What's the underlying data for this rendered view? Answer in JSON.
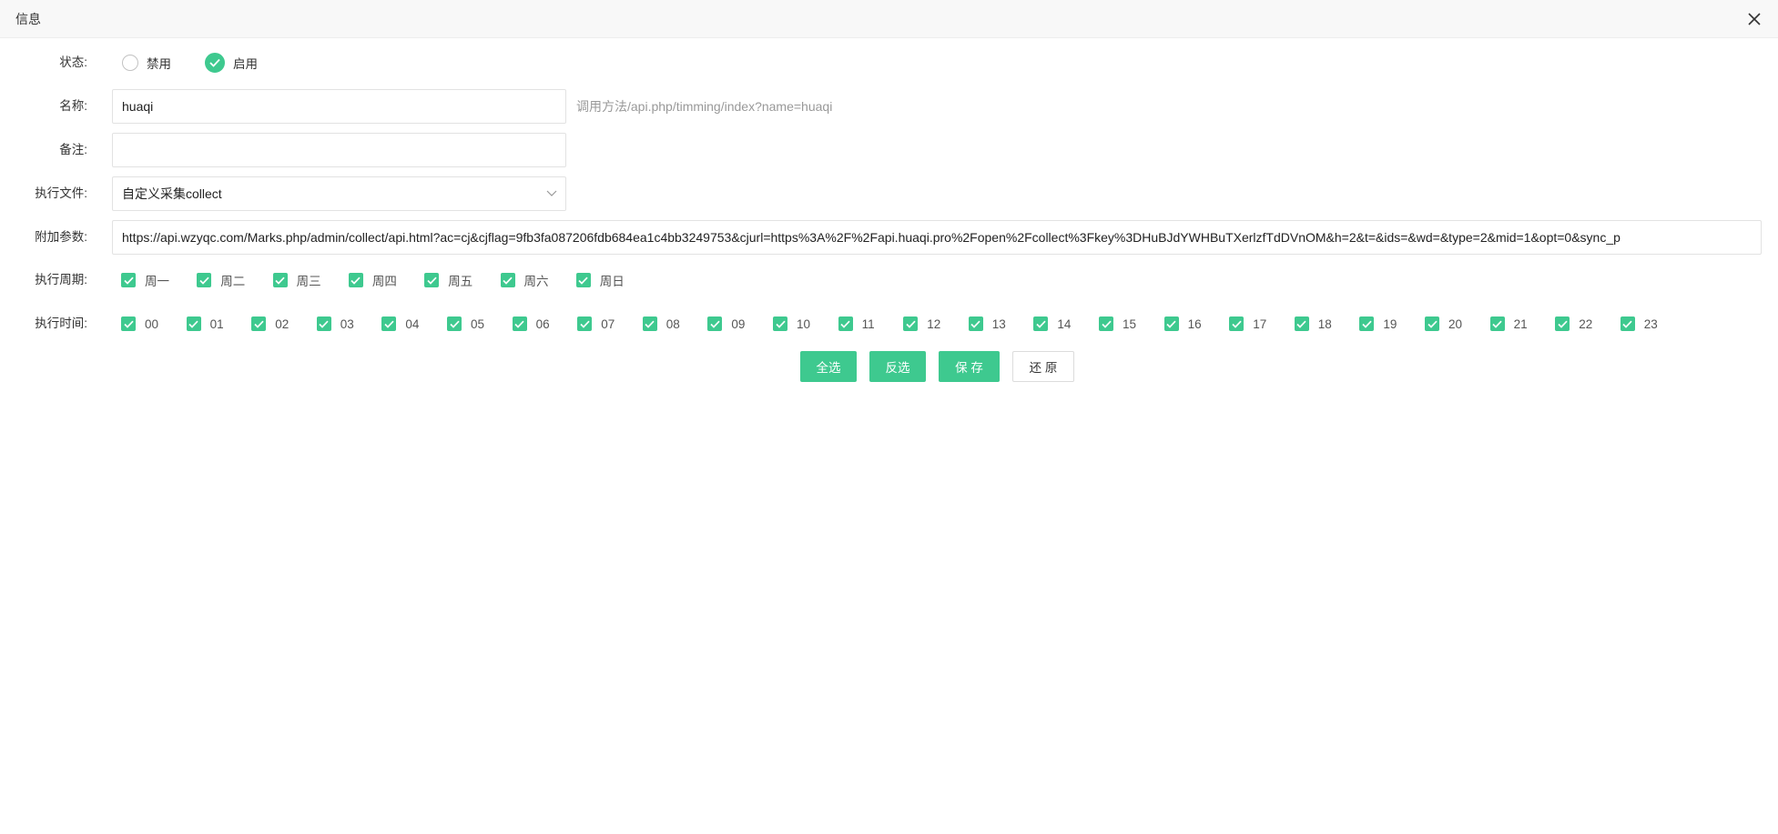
{
  "dialog": {
    "title": "信息"
  },
  "form": {
    "status": {
      "label": "状态:",
      "options": [
        {
          "label": "禁用",
          "selected": false
        },
        {
          "label": "启用",
          "selected": true
        }
      ]
    },
    "name": {
      "label": "名称:",
      "value": "huaqi",
      "hint": "调用方法/api.php/timming/index?name=huaqi"
    },
    "remark": {
      "label": "备注:",
      "value": ""
    },
    "exec_file": {
      "label": "执行文件:",
      "selected": "自定义采集collect"
    },
    "params": {
      "label": "附加参数:",
      "value": "https://api.wzyqc.com/Marks.php/admin/collect/api.html?ac=cj&cjflag=9fb3fa087206fdb684ea1c4bb3249753&cjurl=https%3A%2F%2Fapi.huaqi.pro%2Fopen%2Fcollect%3Fkey%3DHuBJdYWHBuTXerlzfTdDVnOM&h=2&t=&ids=&wd=&type=2&mid=1&opt=0&sync_p"
    },
    "weekdays": {
      "label": "执行周期:",
      "items": [
        {
          "label": "周一",
          "checked": true
        },
        {
          "label": "周二",
          "checked": true
        },
        {
          "label": "周三",
          "checked": true
        },
        {
          "label": "周四",
          "checked": true
        },
        {
          "label": "周五",
          "checked": true
        },
        {
          "label": "周六",
          "checked": true
        },
        {
          "label": "周日",
          "checked": true
        }
      ]
    },
    "hours": {
      "label": "执行时间:",
      "items": [
        {
          "label": "00",
          "checked": true
        },
        {
          "label": "01",
          "checked": true
        },
        {
          "label": "02",
          "checked": true
        },
        {
          "label": "03",
          "checked": true
        },
        {
          "label": "04",
          "checked": true
        },
        {
          "label": "05",
          "checked": true
        },
        {
          "label": "06",
          "checked": true
        },
        {
          "label": "07",
          "checked": true
        },
        {
          "label": "08",
          "checked": true
        },
        {
          "label": "09",
          "checked": true
        },
        {
          "label": "10",
          "checked": true
        },
        {
          "label": "11",
          "checked": true
        },
        {
          "label": "12",
          "checked": true
        },
        {
          "label": "13",
          "checked": true
        },
        {
          "label": "14",
          "checked": true
        },
        {
          "label": "15",
          "checked": true
        },
        {
          "label": "16",
          "checked": true
        },
        {
          "label": "17",
          "checked": true
        },
        {
          "label": "18",
          "checked": true
        },
        {
          "label": "19",
          "checked": true
        },
        {
          "label": "20",
          "checked": true
        },
        {
          "label": "21",
          "checked": true
        },
        {
          "label": "22",
          "checked": true
        },
        {
          "label": "23",
          "checked": true
        }
      ]
    }
  },
  "buttons": {
    "select_all": "全选",
    "invert": "反选",
    "save": "保 存",
    "reset": "还 原"
  },
  "colors": {
    "accent": "#3ec98f",
    "hint": "#999999",
    "border": "#e2e2e2"
  }
}
